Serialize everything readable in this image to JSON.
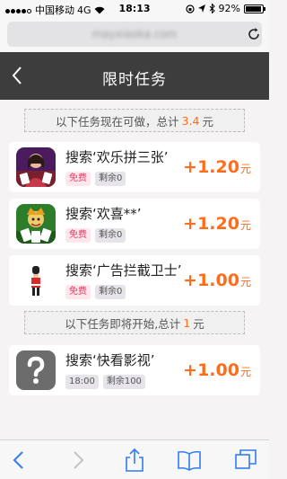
{
  "status_bar": {
    "carrier": "中国移动",
    "network": "4G",
    "time": "18:13",
    "battery": "92%",
    "battery_level": 0.92
  },
  "browser": {
    "url": "mayxiaoka.com"
  },
  "header": {
    "title": "限时任务"
  },
  "available_banner": {
    "prefix": "以下任务现在可做，总计",
    "amount": "3.4",
    "suffix": "元"
  },
  "tasks": [
    {
      "label": "搜索‘欢乐拼三张’",
      "tag1": "免费",
      "tag2": "剩余0",
      "amount": "+1.20",
      "unit": "元"
    },
    {
      "label": "搜索‘欢喜**’",
      "tag1": "免费",
      "tag2": "剩余0",
      "amount": "+1.20",
      "unit": "元"
    },
    {
      "label": "搜索‘广告拦截卫士’",
      "tag1": "免费",
      "tag2": "剩余0",
      "amount": "+1.00",
      "unit": "元"
    }
  ],
  "upcoming_banner": {
    "prefix": "以下任务即将开始,总计",
    "amount": "1",
    "suffix": "元"
  },
  "upcoming_tasks": [
    {
      "label": "搜索‘快看影视’",
      "tag1": "18:00",
      "tag2": "剩余100",
      "amount": "+1.00",
      "unit": "元"
    }
  ],
  "colors": {
    "accent": "#ff6c1a",
    "header_bg": "#3d3d3d",
    "free_tag": "#e63a64",
    "ios_blue": "#2f7cf6"
  }
}
